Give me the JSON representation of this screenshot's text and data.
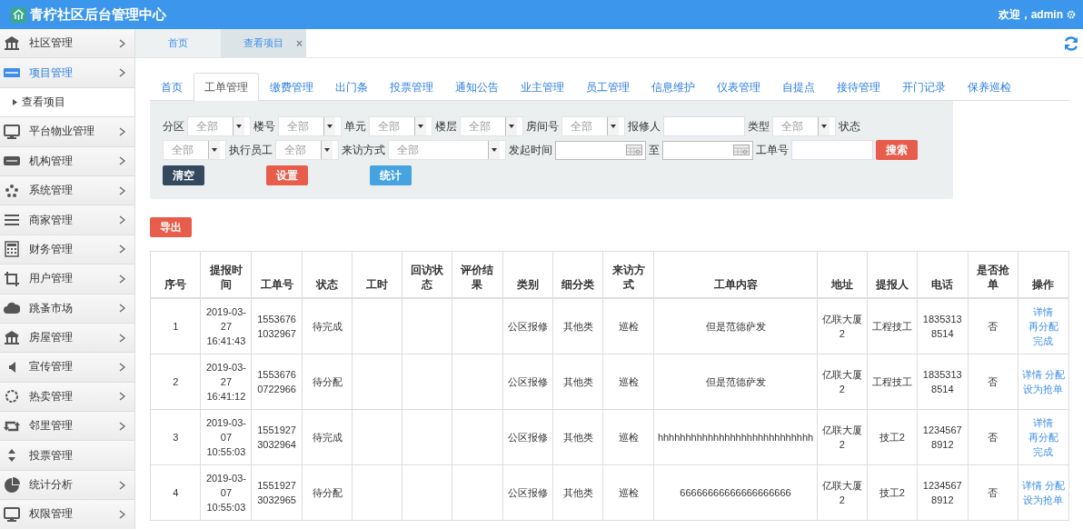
{
  "header": {
    "title": "青柠社区后台管理中心",
    "welcome": "欢迎，admin"
  },
  "sidebar": {
    "items": [
      {
        "label": "社区管理",
        "selected": false,
        "arrow": true
      },
      {
        "label": "项目管理",
        "selected": true,
        "arrow": true,
        "children": [
          {
            "label": "查看项目"
          }
        ]
      },
      {
        "label": "平台物业管理",
        "selected": false,
        "arrow": true
      },
      {
        "label": "机构管理",
        "selected": false,
        "arrow": true
      },
      {
        "label": "系统管理",
        "selected": false,
        "arrow": true
      },
      {
        "label": "商家管理",
        "selected": false,
        "arrow": true
      },
      {
        "label": "财务管理",
        "selected": false,
        "arrow": true
      },
      {
        "label": "用户管理",
        "selected": false,
        "arrow": true
      },
      {
        "label": "跳蚤市场",
        "selected": false,
        "arrow": true
      },
      {
        "label": "房屋管理",
        "selected": false,
        "arrow": true
      },
      {
        "label": "宣传管理",
        "selected": false,
        "arrow": true
      },
      {
        "label": "热卖管理",
        "selected": false,
        "arrow": true
      },
      {
        "label": "邻里管理",
        "selected": false,
        "arrow": true
      },
      {
        "label": "投票管理",
        "selected": false,
        "arrow": false
      },
      {
        "label": "统计分析",
        "selected": false,
        "arrow": true
      },
      {
        "label": "权限管理",
        "selected": false,
        "arrow": true
      }
    ]
  },
  "page_tabs": [
    {
      "label": "首页",
      "selected": false
    },
    {
      "label": "查看项目",
      "selected": true,
      "close": "×"
    }
  ],
  "nav_tabs": [
    {
      "label": "首页",
      "selected": false
    },
    {
      "label": "工单管理",
      "selected": true
    },
    {
      "label": "缴费管理",
      "selected": false
    },
    {
      "label": "出门条",
      "selected": false
    },
    {
      "label": "投票管理",
      "selected": false
    },
    {
      "label": "通知公告",
      "selected": false
    },
    {
      "label": "业主管理",
      "selected": false
    },
    {
      "label": "员工管理",
      "selected": false
    },
    {
      "label": "信息维护",
      "selected": false
    },
    {
      "label": "仪表管理",
      "selected": false
    },
    {
      "label": "自提点",
      "selected": false
    },
    {
      "label": "接待管理",
      "selected": false
    },
    {
      "label": "开门记录",
      "selected": false
    },
    {
      "label": "保养巡检",
      "selected": false
    }
  ],
  "filters": [
    [
      {
        "kind": "label",
        "text": "分区"
      },
      {
        "kind": "select",
        "value": "全部"
      },
      {
        "kind": "label",
        "text": "楼号"
      },
      {
        "kind": "select",
        "value": "全部"
      },
      {
        "kind": "label",
        "text": "单元"
      },
      {
        "kind": "select",
        "value": "全部"
      },
      {
        "kind": "label",
        "text": "楼层"
      },
      {
        "kind": "select",
        "value": "全部"
      },
      {
        "kind": "label",
        "text": "房间号"
      },
      {
        "kind": "select",
        "value": "全部"
      },
      {
        "kind": "label",
        "text": "报修人"
      },
      {
        "kind": "input"
      },
      {
        "kind": "label",
        "text": "类型"
      },
      {
        "kind": "select",
        "value": "全部"
      },
      {
        "kind": "label",
        "text": "状态"
      }
    ],
    [
      {
        "kind": "select",
        "value": "全部"
      },
      {
        "kind": "label",
        "text": "执行员工"
      },
      {
        "kind": "select",
        "value": "全部"
      },
      {
        "kind": "label",
        "text": "来访方式"
      },
      {
        "kind": "select",
        "value": "全部",
        "wide": true
      },
      {
        "kind": "label",
        "text": "发起时间"
      },
      {
        "kind": "date"
      },
      {
        "kind": "label",
        "text": "至"
      },
      {
        "kind": "date"
      },
      {
        "kind": "label",
        "text": "工单号"
      },
      {
        "kind": "input"
      },
      {
        "kind": "button",
        "text": "搜索",
        "color": "#e85c4b"
      }
    ],
    [
      {
        "kind": "button",
        "text": "清空",
        "color": "#34495e"
      },
      {
        "kind": "button",
        "text": "设置",
        "color": "#e85c4b"
      },
      {
        "kind": "button",
        "text": "统计",
        "color": "#45a3df"
      }
    ]
  ],
  "export_button": {
    "text": "导出",
    "color": "#e85c4b"
  },
  "table": {
    "columns": [
      "序号",
      "提报时间",
      "工单号",
      "状态",
      "工时",
      "回访状态",
      "评价结果",
      "类别",
      "细分类",
      "来访方式",
      "工单内容",
      "地址",
      "提报人",
      "电话",
      "是否抢单",
      "操作"
    ],
    "rows": [
      {
        "index": "1",
        "time": "2019-03-27 16:41:43",
        "number": "15536761032967",
        "status": "待完成",
        "category": "公区报修",
        "subcategory": "其他类",
        "visit": "巡检",
        "content": "但是范德萨发",
        "address": "亿联大厦2",
        "reporter": "工程技工",
        "phone": "18353138514",
        "grab": "否",
        "actions": [
          "详情",
          "再分配",
          "完成"
        ]
      },
      {
        "index": "2",
        "time": "2019-03-27 16:41:12",
        "number": "15536760722966",
        "status": "待分配",
        "category": "公区报修",
        "subcategory": "其他类",
        "visit": "巡检",
        "content": "但是范德萨发",
        "address": "亿联大厦2",
        "reporter": "工程技工",
        "phone": "18353138514",
        "grab": "否",
        "actions": [
          "详情",
          "分配",
          "设为抢单"
        ]
      },
      {
        "index": "3",
        "time": "2019-03-07 10:55:03",
        "number": "15519273032964",
        "status": "待完成",
        "category": "公区报修",
        "subcategory": "其他类",
        "visit": "巡检",
        "content": "hhhhhhhhhhhhhhhhhhhhhhhhhhhh",
        "address": "亿联大厦2",
        "reporter": "技工2",
        "phone": "12345678912",
        "grab": "否",
        "actions": [
          "详情",
          "再分配",
          "完成"
        ]
      },
      {
        "index": "4",
        "time": "2019-03-07 10:55:03",
        "number": "15519273032965",
        "status": "待分配",
        "category": "公区报修",
        "subcategory": "其他类",
        "visit": "巡检",
        "content": "66666666666666666666",
        "address": "亿联大厦2",
        "reporter": "技工2",
        "phone": "12345678912",
        "grab": "否",
        "actions": [
          "详情",
          "分配",
          "设为抢单"
        ]
      }
    ]
  }
}
